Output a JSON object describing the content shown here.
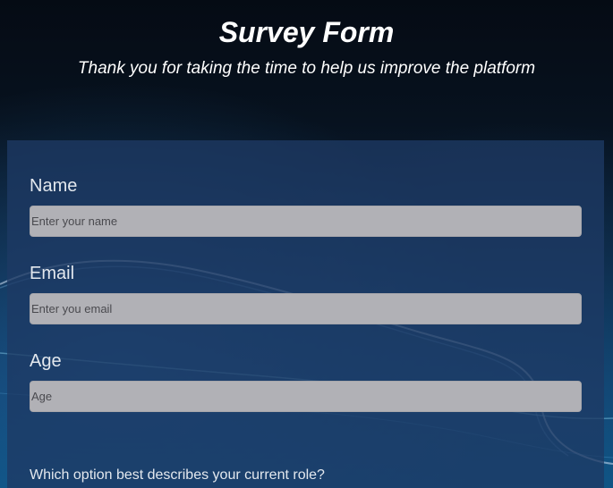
{
  "header": {
    "title": "Survey Form",
    "subtitle": "Thank you for taking the time to help us improve the platform"
  },
  "form": {
    "name": {
      "label": "Name",
      "placeholder": "Enter your name",
      "value": ""
    },
    "email": {
      "label": "Email",
      "placeholder": "Enter you email",
      "value": ""
    },
    "age": {
      "label": "Age",
      "placeholder": "Age",
      "value": ""
    },
    "role_question": "Which option best describes your current role?"
  },
  "colors": {
    "panel": "#1e3a64",
    "input_bg": "#b1b1b6",
    "label": "#e3e8ee"
  }
}
